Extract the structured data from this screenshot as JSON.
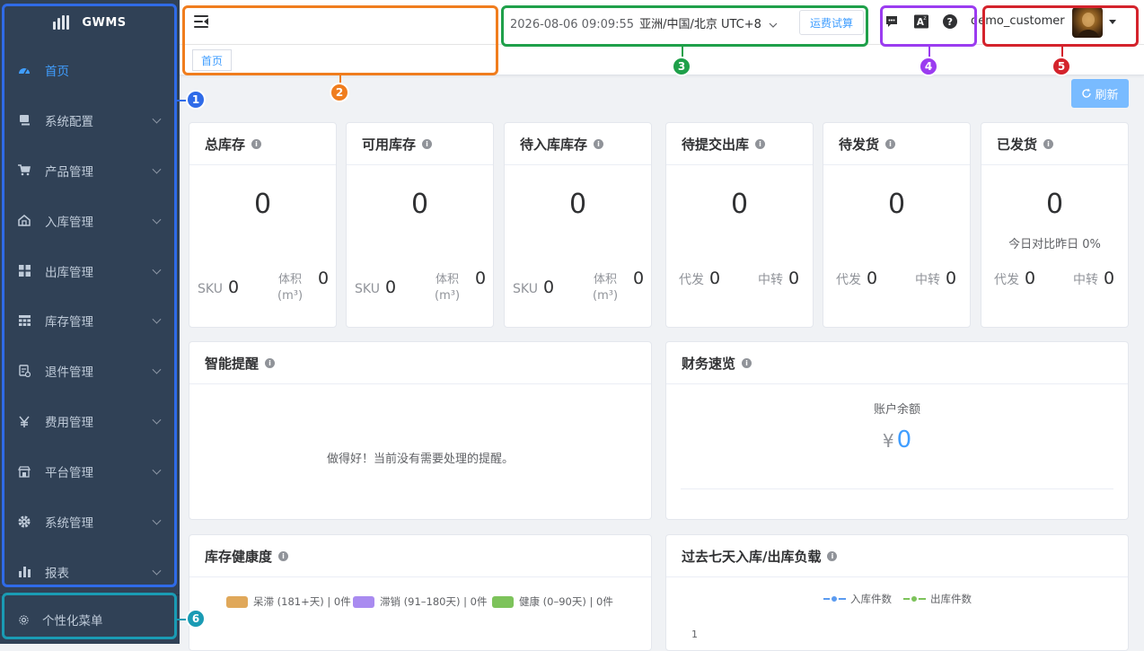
{
  "app": {
    "name": "GWMS"
  },
  "sidebar": {
    "items": [
      {
        "label": "首页",
        "icon": "dashboard-icon",
        "active": true
      },
      {
        "label": "系统配置",
        "icon": "monitor-icon"
      },
      {
        "label": "产品管理",
        "icon": "cart-icon"
      },
      {
        "label": "入库管理",
        "icon": "warehouse-in-icon"
      },
      {
        "label": "出库管理",
        "icon": "grid-icon"
      },
      {
        "label": "库存管理",
        "icon": "table-icon"
      },
      {
        "label": "退件管理",
        "icon": "return-doc-icon"
      },
      {
        "label": "费用管理",
        "icon": "yen-icon"
      },
      {
        "label": "平台管理",
        "icon": "store-icon"
      },
      {
        "label": "系统管理",
        "icon": "settings-icon"
      },
      {
        "label": "报表",
        "icon": "bar-chart-icon"
      }
    ],
    "bottom_label": "个性化菜单"
  },
  "header": {
    "datetime": "2026-08-06 09:09:55",
    "timezone": "亚洲/中国/北京 UTC+8",
    "freight_button": "运费试算",
    "username": "demo_customer"
  },
  "tags": {
    "home": "首页"
  },
  "toolbar": {
    "refresh": "刷新"
  },
  "stats": {
    "total": {
      "title": "总库存",
      "value": "0",
      "sku_label": "SKU",
      "sku": "0",
      "vol_label": "体积",
      "vol_unit": "(m³)",
      "vol": "0"
    },
    "available": {
      "title": "可用库存",
      "value": "0",
      "sku_label": "SKU",
      "sku": "0",
      "vol_label": "体积",
      "vol_unit": "(m³)",
      "vol": "0"
    },
    "pending_in": {
      "title": "待入库库存",
      "value": "0",
      "sku_label": "SKU",
      "sku": "0",
      "vol_label": "体积",
      "vol_unit": "(m³)",
      "vol": "0"
    },
    "pending_submit": {
      "title": "待提交出库",
      "value": "0",
      "a_label": "代发",
      "a": "0",
      "b_label": "中转",
      "b": "0"
    },
    "pending_ship": {
      "title": "待发货",
      "value": "0",
      "a_label": "代发",
      "a": "0",
      "b_label": "中转",
      "b": "0"
    },
    "shipped": {
      "title": "已发货",
      "value": "0",
      "compare": "今日对比昨日 0%",
      "a_label": "代发",
      "a": "0",
      "b_label": "中转",
      "b": "0"
    }
  },
  "alerts": {
    "title": "智能提醒",
    "empty": "做得好！当前没有需要处理的提醒。"
  },
  "finance": {
    "title": "财务速览",
    "balance_label": "账户余额",
    "currency": "¥",
    "balance": "0"
  },
  "health": {
    "title": "库存健康度",
    "legend": [
      {
        "label": "呆滞 (181+天) | 0件",
        "color": "#e0a85a"
      },
      {
        "label": "滞销 (91–180天) | 0件",
        "color": "#a98bf0"
      },
      {
        "label": "健康 (0–90天) | 0件",
        "color": "#7dc35b"
      }
    ]
  },
  "load": {
    "title": "过去七天入库/出库负载",
    "chart_data": {
      "type": "line",
      "series": [
        {
          "name": "入库件数",
          "color": "#5b9bf0",
          "values": []
        },
        {
          "name": "出库件数",
          "color": "#7dc35b",
          "values": []
        }
      ],
      "ytick_top": "1"
    }
  },
  "annotations": [
    "1",
    "2",
    "3",
    "4",
    "5",
    "6"
  ],
  "colors": {
    "accent": "#409eff",
    "sidebar": "#304156"
  }
}
